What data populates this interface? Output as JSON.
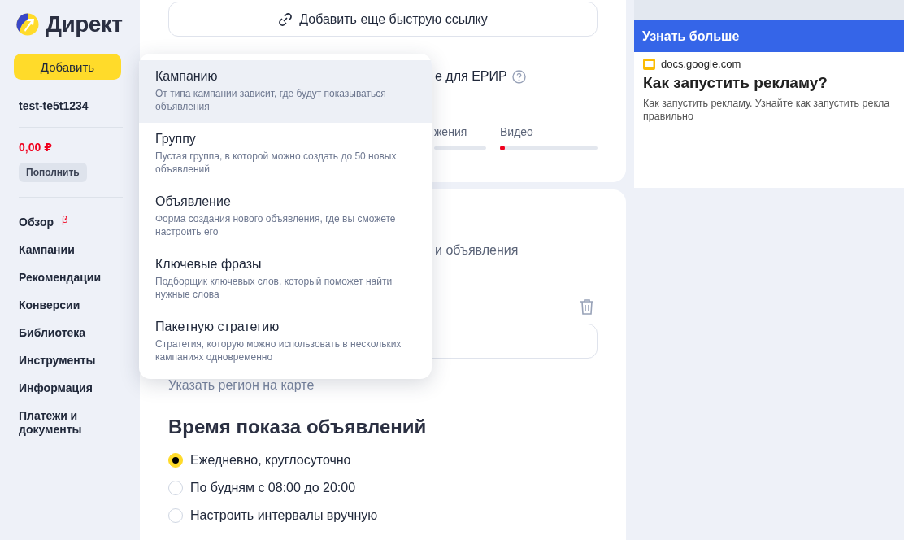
{
  "sidebar": {
    "logo": "Директ",
    "add_button": "Добавить",
    "account": "test-te5t1234",
    "balance": "0,00 ₽",
    "topup_button": "Пополнить",
    "nav": [
      {
        "label": "Обзор",
        "badge": "β"
      },
      {
        "label": "Кампании"
      },
      {
        "label": "Рекомендации"
      },
      {
        "label": "Конверсии"
      },
      {
        "label": "Библиотека"
      },
      {
        "label": "Инструменты"
      },
      {
        "label": "Информация"
      },
      {
        "label": "Платежи и документы"
      }
    ]
  },
  "card_top": {
    "quick_link_button": "Добавить еще быструю ссылку",
    "erir_label": "е для ЕРИР",
    "tabs": [
      {
        "label": "жения",
        "warning": false
      },
      {
        "label": "Видео",
        "warning": true
      }
    ]
  },
  "card_bottom": {
    "label": "и объявления",
    "region_link": "Указать регион на карте",
    "schedule_title": "Время показа объявлений",
    "options": [
      {
        "label": "Ежедневно, круглосуточно",
        "selected": true
      },
      {
        "label": "По будням с 08:00 до 20:00",
        "selected": false
      },
      {
        "label": "Настроить интервалы вручную",
        "selected": false
      }
    ]
  },
  "menu": {
    "items": [
      {
        "title": "Кампанию",
        "description": "От типа кампании зависит, где будут показываться объявления",
        "selected": true
      },
      {
        "title": "Группу",
        "description": "Пустая группа, в которой можно создать до 50 новых объявлений",
        "selected": false
      },
      {
        "title": "Объявление",
        "description": "Форма создания нового объявления, где вы сможете настроить его",
        "selected": false
      },
      {
        "title": "Ключевые фразы",
        "description": "Подборщик ключевых слов, который поможет найти нужные слова",
        "selected": false
      },
      {
        "title": "Пакетную стратегию",
        "description": "Стратегия, которую можно использовать в нескольких кампаниях одновременно",
        "selected": false
      }
    ]
  },
  "side_panel": {
    "header": "Узнать больше",
    "source": "docs.google.com",
    "title": "Как запустить рекламу?",
    "description": "Как запустить рекламу. Узнайте как запустить рекла\nправильно"
  }
}
